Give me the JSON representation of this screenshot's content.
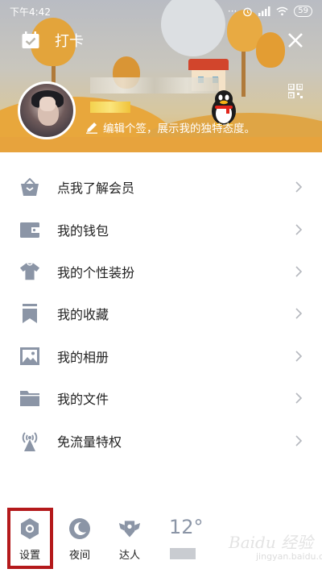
{
  "status_bar": {
    "time": "下午4:42",
    "battery": "59"
  },
  "header": {
    "punch_label": "打卡",
    "signature": "编辑个签，展示我的独特态度。"
  },
  "menu": {
    "items": [
      {
        "label": "点我了解会员",
        "icon": "vip-icon"
      },
      {
        "label": "我的钱包",
        "icon": "wallet-icon"
      },
      {
        "label": "我的个性装扮",
        "icon": "shirt-icon"
      },
      {
        "label": "我的收藏",
        "icon": "bookmark-icon"
      },
      {
        "label": "我的相册",
        "icon": "photo-icon"
      },
      {
        "label": "我的文件",
        "icon": "folder-icon"
      },
      {
        "label": "免流量特权",
        "icon": "signal-tower-icon"
      }
    ]
  },
  "bottom_bar": {
    "settings_label": "设置",
    "night_label": "夜间",
    "expert_label": "达人",
    "temperature": "12°"
  },
  "watermark": {
    "main": "Baidu 经验",
    "sub": "jingyan.baidu.com"
  },
  "colors": {
    "icon_gray": "#8b95a6",
    "highlight_red": "#b4191b",
    "text": "#222222"
  }
}
